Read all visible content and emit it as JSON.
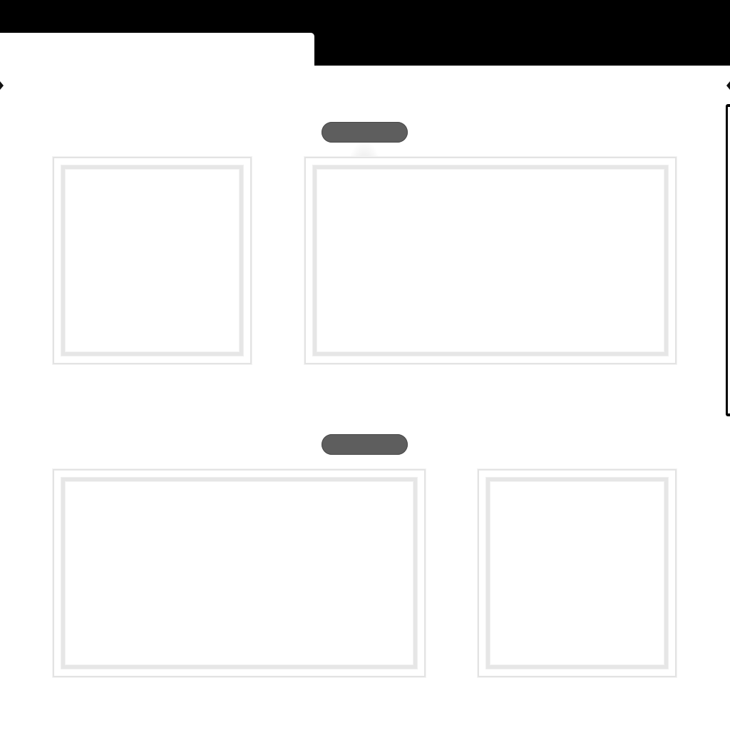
{
  "page": {
    "background_color": "#000000",
    "window_color": "#ffffff",
    "frame_border_color": "#e3e3e3",
    "handle_color": "#5e5e5e"
  },
  "rows": [
    {
      "handle": {
        "icon": "drag-handle-pill"
      },
      "panels": [
        {
          "content": ""
        },
        {
          "content": ""
        }
      ]
    },
    {
      "handle": {
        "icon": "drag-handle-pill"
      },
      "panels": [
        {
          "content": ""
        },
        {
          "content": ""
        }
      ]
    }
  ]
}
